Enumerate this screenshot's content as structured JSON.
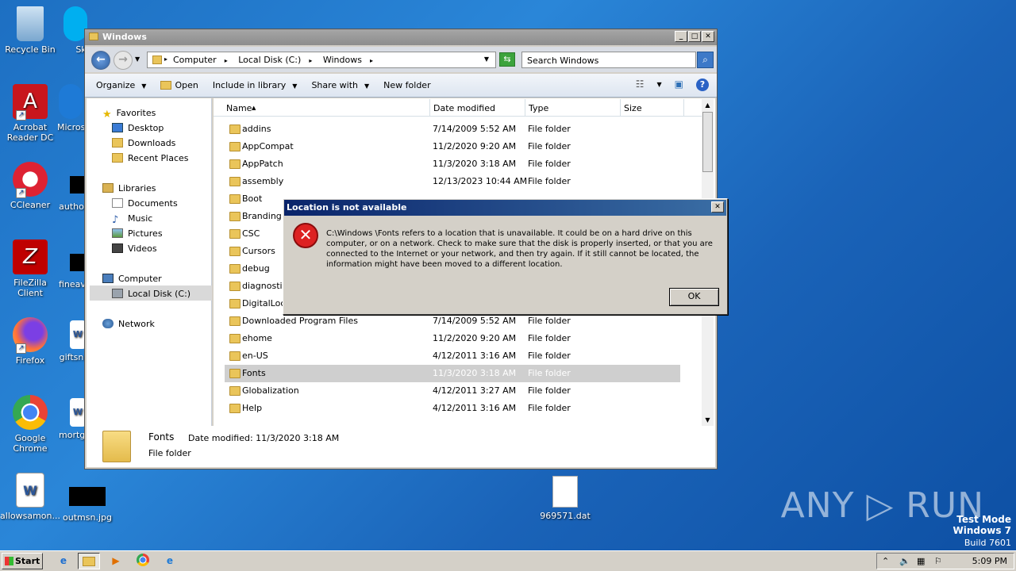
{
  "desktop": {
    "icons": [
      {
        "label": "Recycle Bin"
      },
      {
        "label": "Acrobat Reader DC"
      },
      {
        "label": "CCleaner"
      },
      {
        "label": "FileZilla Client"
      },
      {
        "label": "Firefox"
      },
      {
        "label": "Google Chrome"
      },
      {
        "label": "allowsamon..."
      },
      {
        "label": "Sk"
      },
      {
        "label": "Micros"
      },
      {
        "label": "autho"
      },
      {
        "label": "fineav"
      },
      {
        "label": "giftsn"
      },
      {
        "label": "mortg"
      },
      {
        "label": "outmsn.jpg"
      },
      {
        "label": "969571.dat"
      }
    ],
    "watermark": {
      "brand": "ANY ▷ RUN",
      "mode": "Test Mode",
      "os": "Windows 7",
      "build": "Build 7601"
    }
  },
  "explorer": {
    "title": "Windows",
    "window_buttons": {
      "minimize": "_",
      "maximize": "□",
      "close": "✕"
    },
    "nav": {
      "back": "←",
      "forward": "→"
    },
    "breadcrumb": [
      "Computer",
      "Local Disk (C:)",
      "Windows"
    ],
    "search_placeholder": "Search Windows",
    "toolbar": {
      "organize": "Organize",
      "open": "Open",
      "include": "Include in library",
      "share": "Share with",
      "new_folder": "New folder"
    },
    "navpane": {
      "favorites": "Favorites",
      "desktop": "Desktop",
      "downloads": "Downloads",
      "recent": "Recent Places",
      "libraries": "Libraries",
      "documents": "Documents",
      "music": "Music",
      "pictures": "Pictures",
      "videos": "Videos",
      "computer": "Computer",
      "local_disk": "Local Disk (C:)",
      "network": "Network"
    },
    "columns": {
      "name": "Name",
      "date": "Date modified",
      "type": "Type",
      "size": "Size"
    },
    "files": [
      {
        "name": "addins",
        "date": "7/14/2009 5:52 AM",
        "type": "File folder"
      },
      {
        "name": "AppCompat",
        "date": "11/2/2020 9:20 AM",
        "type": "File folder"
      },
      {
        "name": "AppPatch",
        "date": "11/3/2020 3:18 AM",
        "type": "File folder"
      },
      {
        "name": "assembly",
        "date": "12/13/2023 10:44 AM",
        "type": "File folder"
      },
      {
        "name": "Boot",
        "date": "",
        "type": ""
      },
      {
        "name": "Branding",
        "date": "",
        "type": ""
      },
      {
        "name": "CSC",
        "date": "",
        "type": ""
      },
      {
        "name": "Cursors",
        "date": "",
        "type": ""
      },
      {
        "name": "debug",
        "date": "",
        "type": ""
      },
      {
        "name": "diagnostics",
        "date": "",
        "type": ""
      },
      {
        "name": "DigitalLock",
        "date": "",
        "type": ""
      },
      {
        "name": "Downloaded Program Files",
        "date": "7/14/2009 5:52 AM",
        "type": "File folder"
      },
      {
        "name": "ehome",
        "date": "11/2/2020 9:20 AM",
        "type": "File folder"
      },
      {
        "name": "en-US",
        "date": "4/12/2011 3:16 AM",
        "type": "File folder"
      },
      {
        "name": "Fonts",
        "date": "11/3/2020 3:18 AM",
        "type": "File folder"
      },
      {
        "name": "Globalization",
        "date": "4/12/2011 3:27 AM",
        "type": "File folder"
      },
      {
        "name": "Help",
        "date": "4/12/2011 3:16 AM",
        "type": "File folder"
      }
    ],
    "details": {
      "name": "Fonts",
      "date_label": "Date modified: 11/3/2020 3:18 AM",
      "type": "File folder"
    }
  },
  "dialog": {
    "title": "Location is not available",
    "message": "C:\\Windows \\Fonts refers to a location that is unavailable. It could be on a hard drive on this computer, or on a network. Check to make sure that the disk is properly inserted, or that you are connected to the Internet or your network, and then try again. If it still cannot be located, the information might have been moved to a different location.",
    "ok": "OK",
    "close": "✕",
    "icon": "error-icon"
  },
  "taskbar": {
    "start": "Start",
    "clock": "5:09 PM"
  },
  "colors": {
    "desktop": "#1d6fc2",
    "dialog_title": "#0a246a",
    "folder": "#eac55a"
  }
}
